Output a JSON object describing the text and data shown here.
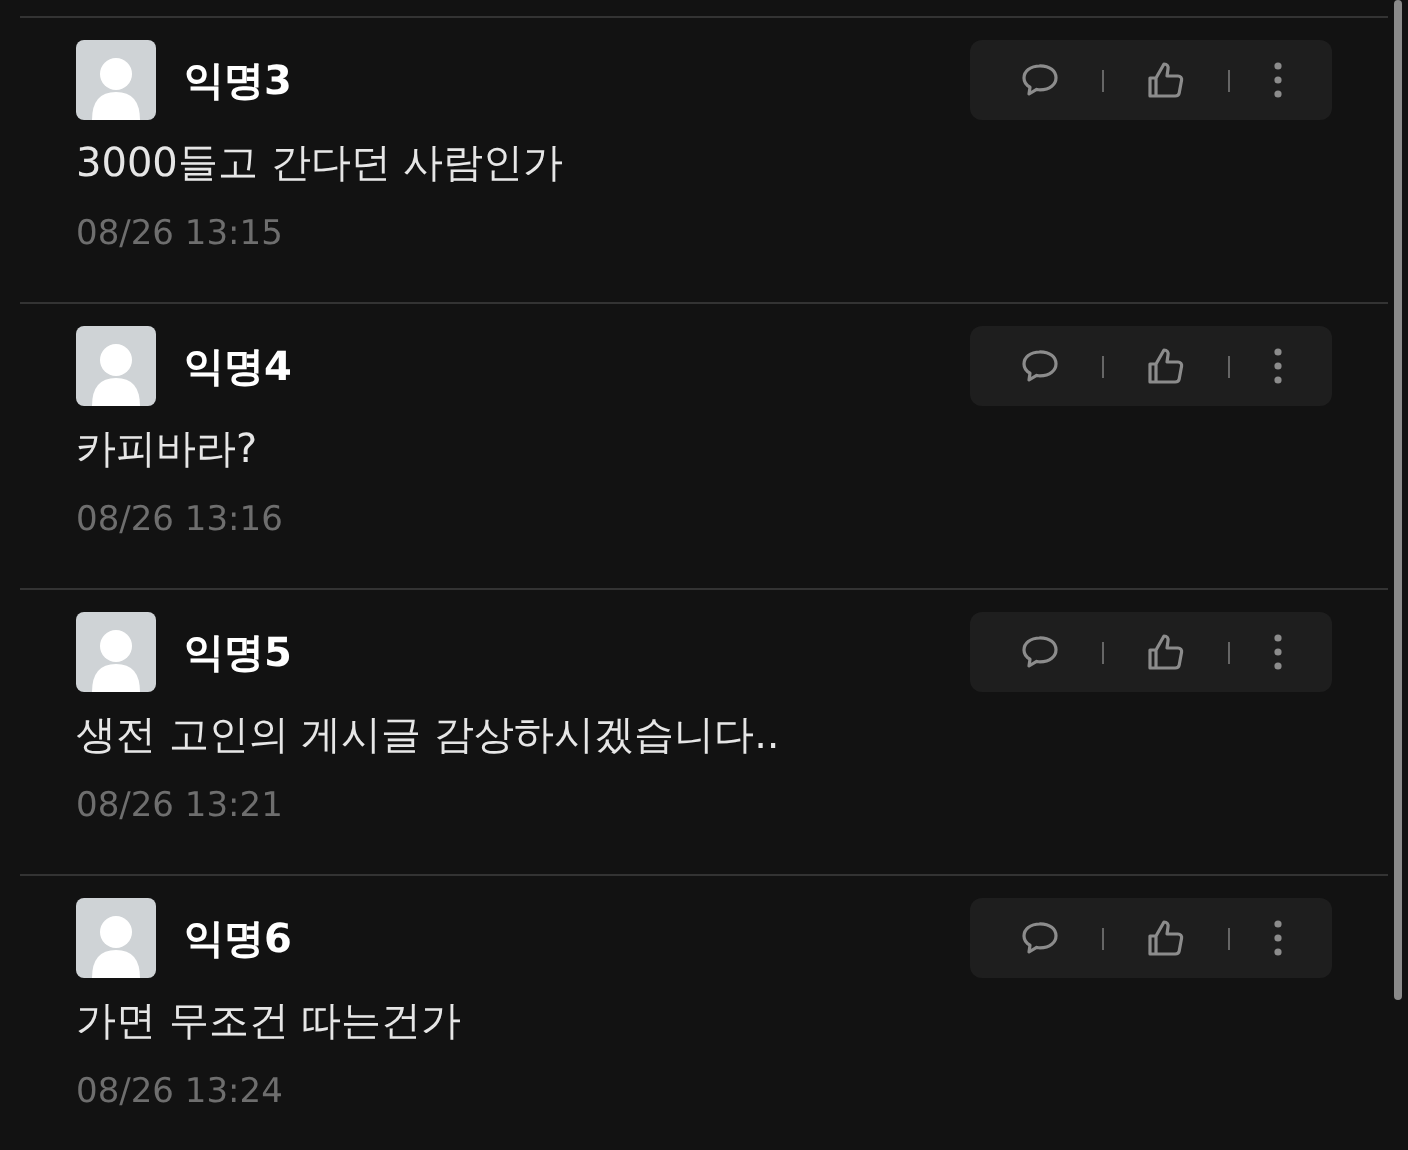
{
  "comments": [
    {
      "author": "익명3",
      "text": "3000들고 간다던 사람인가",
      "time": "08/26 13:15"
    },
    {
      "author": "익명4",
      "text": "카피바라?",
      "time": "08/26 13:16"
    },
    {
      "author": "익명5",
      "text": "생전 고인의 게시글 감상하시겠습니다..",
      "time": "08/26 13:21"
    },
    {
      "author": "익명6",
      "text": "가면 무조건 따는건가",
      "time": "08/26 13:24"
    }
  ]
}
